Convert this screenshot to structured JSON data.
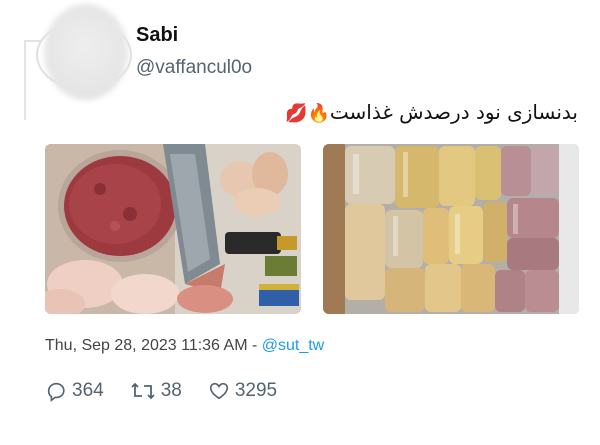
{
  "author": {
    "name": "Sabi",
    "handle": "@vaffancul0o"
  },
  "tweet": {
    "text": "بدنسازی نود درصدش غذاست",
    "emojis": [
      "🔥",
      "💋"
    ]
  },
  "media": [
    {
      "description": "meat-and-fish-groceries"
    },
    {
      "description": "bagged-meat-portions"
    }
  ],
  "meta": {
    "timestamp": "Thu, Sep 28, 2023 11:36 AM",
    "separator": " - ",
    "source": "@sut_tw"
  },
  "stats": {
    "replies": "364",
    "retweets": "38",
    "likes": "3295"
  },
  "colors": {
    "link": "#1d9bf0",
    "muted": "#536471"
  }
}
